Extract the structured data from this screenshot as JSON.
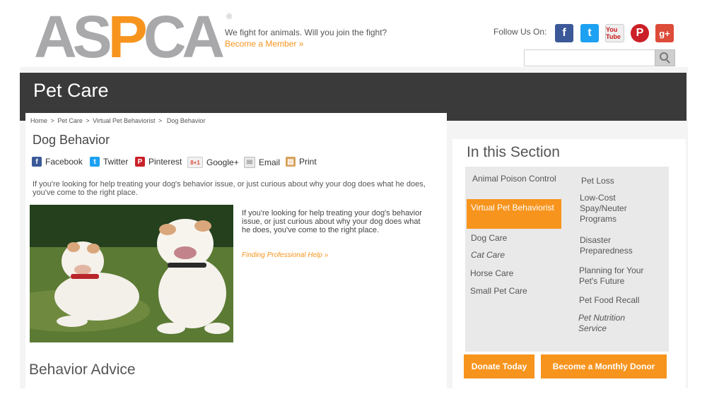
{
  "header": {
    "logo": {
      "part1": "AS",
      "part2": "P",
      "part3": "CA",
      "mark": "®"
    },
    "tagline": "We fight for animals. Will you join the fight?",
    "member_link": "Become a Member »",
    "follow_label": "Follow Us On:",
    "social": [
      {
        "name": "facebook-icon",
        "glyph": "f"
      },
      {
        "name": "twitter-icon",
        "glyph": "t"
      },
      {
        "name": "youtube-icon",
        "glyph": "You Tube"
      },
      {
        "name": "pinterest-icon",
        "glyph": "P"
      },
      {
        "name": "googleplus-icon",
        "glyph": "g+"
      }
    ],
    "search": {
      "placeholder": ""
    }
  },
  "banner": {
    "title": "Pet Care"
  },
  "breadcrumb": [
    "Home",
    "Pet Care",
    "Virtual Pet Behaviorist",
    "Dog Behavior"
  ],
  "breadcrumb_sep": ">",
  "page": {
    "title": "Dog Behavior",
    "share": {
      "facebook": "Facebook",
      "twitter": "Twitter",
      "pinterest": "Pinterest",
      "google": "Google+",
      "email": "Email",
      "print": "Print"
    },
    "intro": "If you're looking for help treating your dog's behavior issue, or just curious about why your dog does what he does, you've come to the right place.",
    "side_text": "If you're looking for help treating your dog's behavior issue, or just curious about why your dog does what he does, you've come to the right place.",
    "pro_link": "Finding Professional Help »",
    "subheading": "Behavior Advice"
  },
  "section": {
    "title": "In this Section",
    "left_items": [
      {
        "label": "Animal Poison Control",
        "italic": false
      },
      {
        "label": "Virtual Pet Behaviorist",
        "italic": false,
        "active": true
      },
      {
        "label": "Dog Care",
        "italic": false
      },
      {
        "label": "Cat Care",
        "italic": true
      },
      {
        "label": "Horse Care",
        "italic": false
      },
      {
        "label": "Small Pet Care",
        "italic": false
      }
    ],
    "right_items": [
      {
        "label": "Pet Loss",
        "italic": false
      },
      {
        "label": "Low-Cost Spay/Neuter Programs",
        "italic": false
      },
      {
        "label": "Disaster Preparedness",
        "italic": false
      },
      {
        "label": "Planning for Your Pet's Future",
        "italic": false
      },
      {
        "label": "Pet Food Recall",
        "italic": false
      },
      {
        "label": "Pet Nutrition Service",
        "italic": true
      }
    ],
    "donate_button": "Donate Today",
    "monthly_button": "Become a Monthly Donor"
  },
  "colors": {
    "accent": "#f7941d",
    "banner": "#3a3a3a",
    "logo_grey": "#a9a9ab"
  }
}
